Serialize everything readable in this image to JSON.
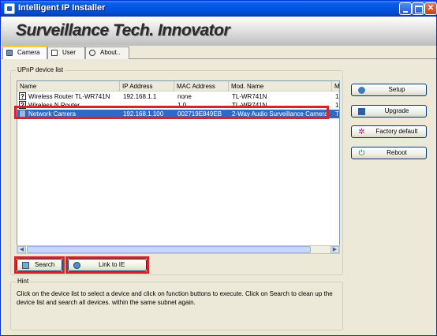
{
  "window": {
    "title": "Intelligent IP Installer"
  },
  "banner": {
    "slogan": "Surveillance Tech. Innovator"
  },
  "tabs": [
    {
      "label": "Camera",
      "icon": "camera-icon"
    },
    {
      "label": "User",
      "icon": "user-icon"
    },
    {
      "label": "About..",
      "icon": "about-icon"
    }
  ],
  "upnp": {
    "group_title": "UPnP device list",
    "columns": [
      "Name",
      "IP Address",
      "MAC Address",
      "Mod. Name",
      "M"
    ],
    "rows": [
      {
        "name": "Wireless Router TL-WR741N",
        "ip": "192.168.1.1",
        "mac": "none",
        "model": "TL-WR741N",
        "m": "1",
        "icon": "question-icon"
      },
      {
        "name": "Wireless N Router",
        "ip": "",
        "mac": "1.0",
        "model": "TL-WR741N",
        "m": "1",
        "icon": "question-icon"
      },
      {
        "name": "Network Camera",
        "ip": "192.168.1.100",
        "mac": "002719E849EB",
        "model": "2-Way Audio Surveillance Camera",
        "m": "T",
        "icon": "camera-icon",
        "selected": true
      }
    ]
  },
  "actions": {
    "search_label": "Search",
    "link_label": "Link to IE"
  },
  "side_buttons": [
    {
      "label": "Setup",
      "icon": "setup-icon"
    },
    {
      "label": "Upgrade",
      "icon": "upgrade-icon"
    },
    {
      "label": "Factory default",
      "icon": "factory-default-icon"
    },
    {
      "label": "Reboot",
      "icon": "power-icon"
    }
  ],
  "hint": {
    "group_title": "Hint",
    "text": "Click on the device list to select a device and click on function buttons to execute. Click on Search to clean up the device list and search all devices.  within the same subnet again."
  },
  "colors": {
    "selection": "#316ac5",
    "highlight": "#d8232a",
    "titlebar": "#0054e3"
  }
}
